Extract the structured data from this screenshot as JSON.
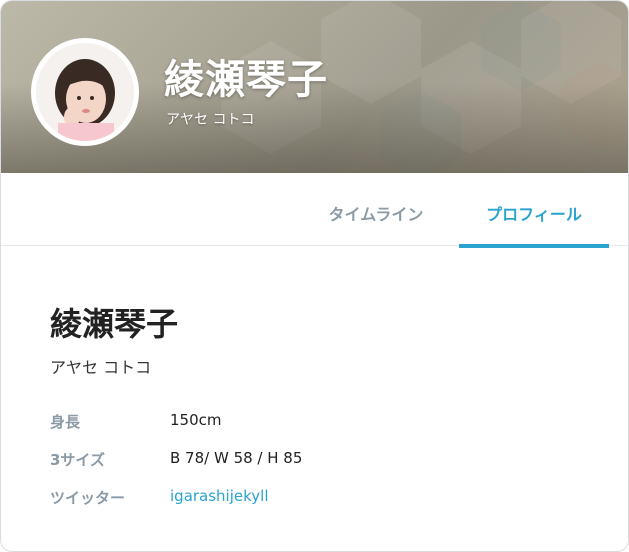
{
  "banner": {
    "name": "綾瀬琴子",
    "kana": "アヤセ コトコ"
  },
  "tabs": [
    {
      "label": "タイムライン",
      "active": false
    },
    {
      "label": "プロフィール",
      "active": true
    }
  ],
  "profile": {
    "name": "綾瀬琴子",
    "kana": "アヤセ コトコ",
    "details": [
      {
        "label": "身長",
        "value": "150cm"
      },
      {
        "label": "3サイズ",
        "value": "B 78/ W 58 / H 85"
      },
      {
        "label": "ツイッター",
        "value": "igarashijekyll"
      }
    ]
  },
  "colors": {
    "accent": "#2aa3cf",
    "tab_inactive": "#8c9aa4",
    "label": "#8a9aa6"
  }
}
